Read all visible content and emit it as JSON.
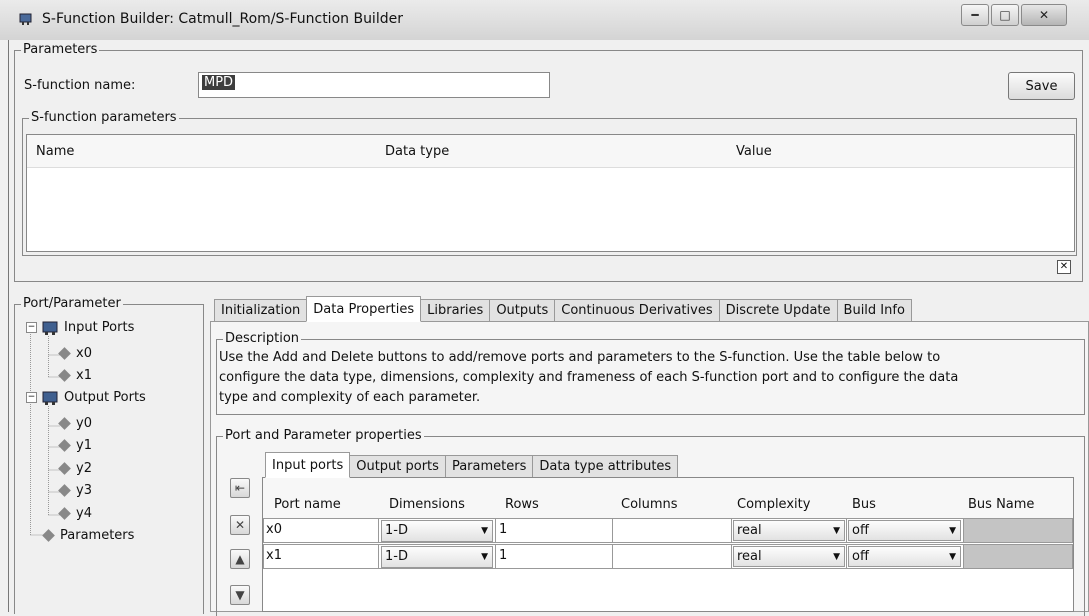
{
  "window": {
    "title": "S-Function Builder: Catmull_Rom/S-Function Builder",
    "app_icon": "simulink-block-icon",
    "controls": [
      "minimize-icon",
      "maximize-icon",
      "close-icon"
    ]
  },
  "parameters": {
    "group_label": "Parameters",
    "name_label": "S-function name:",
    "name_value": "MPD",
    "save_label": "Save"
  },
  "sfunction_params": {
    "group_label": "S-function parameters",
    "columns": [
      "Name",
      "Data type",
      "Value"
    ]
  },
  "port_parameter": {
    "group_label": "Port/Parameter",
    "input_ports_label": "Input Ports",
    "input_ports": [
      "x0",
      "x1"
    ],
    "output_ports_label": "Output Ports",
    "output_ports": [
      "y0",
      "y1",
      "y2",
      "y3",
      "y4"
    ],
    "parameters_label": "Parameters"
  },
  "main_tabs": [
    {
      "label": "Initialization",
      "active": false
    },
    {
      "label": "Data Properties",
      "active": true
    },
    {
      "label": "Libraries",
      "active": false
    },
    {
      "label": "Outputs",
      "active": false
    },
    {
      "label": "Continuous Derivatives",
      "active": false
    },
    {
      "label": "Discrete Update",
      "active": false
    },
    {
      "label": "Build Info",
      "active": false
    }
  ],
  "description": {
    "group_label": "Description",
    "lines": [
      "Use the Add and Delete buttons to add/remove ports and parameters to the S-function. Use the table below to",
      "configure the data type, dimensions, complexity and frameness of each S-function port and to configure the data",
      "type and complexity of each parameter."
    ]
  },
  "port_param_props": {
    "group_label": "Port and Parameter properties",
    "sub_tabs": [
      {
        "label": "Input ports",
        "active": true
      },
      {
        "label": "Output ports",
        "active": false
      },
      {
        "label": "Parameters",
        "active": false
      },
      {
        "label": "Data type attributes",
        "active": false
      }
    ],
    "columns": [
      "Port name",
      "Dimensions",
      "Rows",
      "Columns",
      "Complexity",
      "Bus",
      "Bus Name"
    ],
    "rows": [
      {
        "port_name": "x0",
        "dimensions": "1-D",
        "rows": "1",
        "columns": "",
        "complexity": "real",
        "bus": "off",
        "bus_name": ""
      },
      {
        "port_name": "x1",
        "dimensions": "1-D",
        "rows": "1",
        "columns": "",
        "complexity": "real",
        "bus": "off",
        "bus_name": ""
      }
    ],
    "side_buttons": [
      "add-port-icon",
      "delete-port-icon",
      "move-up-icon",
      "move-down-icon"
    ]
  }
}
